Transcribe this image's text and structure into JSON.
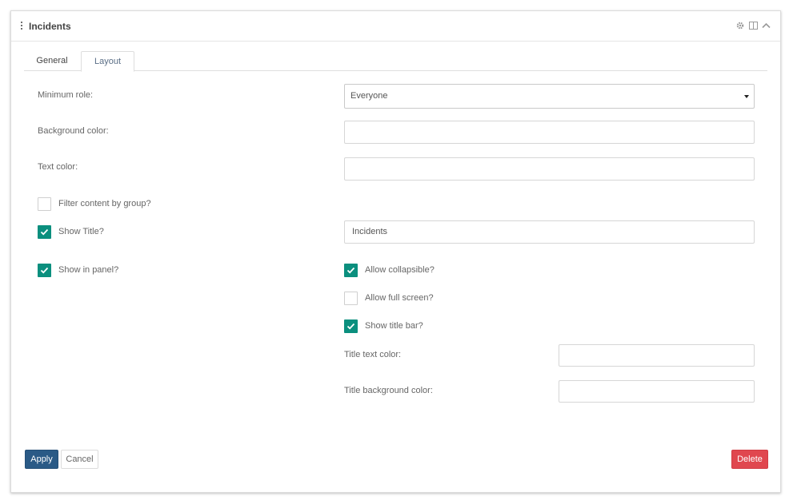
{
  "panel": {
    "title": "Incidents",
    "header_icons": [
      "gear-icon",
      "fullscreen-icon",
      "chevron-up-icon"
    ]
  },
  "tabs": [
    {
      "label": "General",
      "active": false
    },
    {
      "label": "Layout",
      "active": true
    }
  ],
  "form": {
    "minimum_role": {
      "label": "Minimum role:",
      "value": "Everyone"
    },
    "background_color": {
      "label": "Background color:",
      "value": ""
    },
    "text_color": {
      "label": "Text color:",
      "value": ""
    },
    "filter_by_group": {
      "label": "Filter content by group?",
      "checked": false
    },
    "show_title": {
      "label": "Show Title?",
      "checked": true,
      "value": "Incidents"
    },
    "show_in_panel": {
      "label": "Show in panel?",
      "checked": true
    },
    "allow_collapsible": {
      "label": "Allow collapsible?",
      "checked": true
    },
    "allow_full_screen": {
      "label": "Allow full screen?",
      "checked": false
    },
    "show_title_bar": {
      "label": "Show title bar?",
      "checked": true
    },
    "title_text_color": {
      "label": "Title text color:",
      "value": ""
    },
    "title_background_color": {
      "label": "Title background color:",
      "value": ""
    }
  },
  "buttons": {
    "apply": "Apply",
    "cancel": "Cancel",
    "delete": "Delete"
  },
  "colors": {
    "accent": "#0b8f7e",
    "primary": "#2a5a86",
    "danger": "#e0474f"
  }
}
